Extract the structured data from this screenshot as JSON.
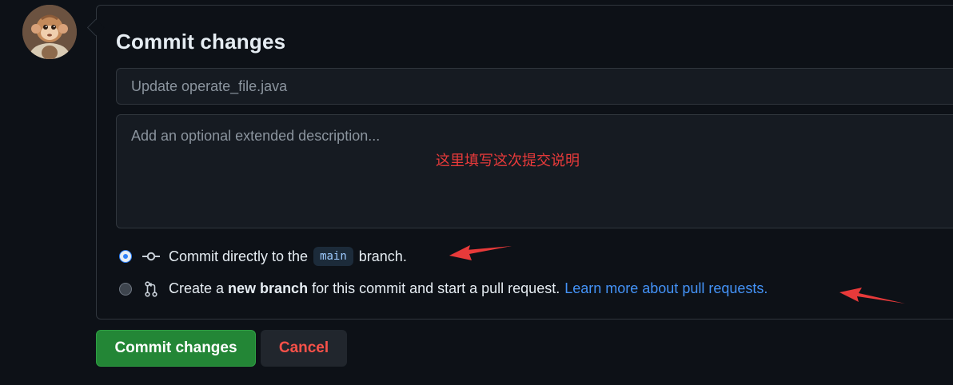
{
  "avatar": {
    "icon": "avatar-monkey-image"
  },
  "commit_panel": {
    "title": "Commit changes",
    "summary_placeholder": "Update operate_file.java",
    "description_placeholder": "Add an optional extended description..."
  },
  "annotation": {
    "note": "这里填写这次提交说明",
    "color": "#e83a3a"
  },
  "options": {
    "direct": {
      "selected": true,
      "icon": "git-commit-icon",
      "text_before": "Commit directly to the",
      "branch": "main",
      "text_after": "branch."
    },
    "new_branch": {
      "selected": false,
      "icon": "git-pull-request-icon",
      "text_before": "Create a",
      "bold_text": "new branch",
      "text_after": "for this commit and start a pull request.",
      "link": "Learn more about pull requests."
    }
  },
  "buttons": {
    "commit": "Commit changes",
    "cancel": "Cancel"
  },
  "colors": {
    "background": "#0d1117",
    "primary_button": "#238636",
    "danger_text": "#f85149",
    "link": "#4493f8",
    "radio_selected": "#2f81f7"
  }
}
